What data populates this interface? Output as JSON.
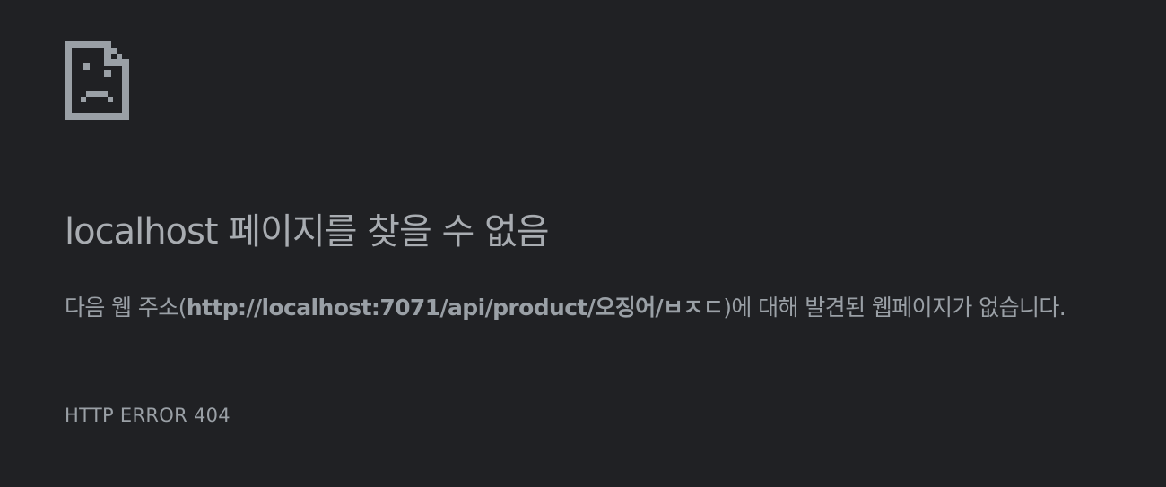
{
  "icon": "sad-page-icon",
  "colors": {
    "background": "#202124",
    "text": "#9aa0a6",
    "title": "#a8acb1",
    "icon": "#9aa0a6"
  },
  "error": {
    "title": "localhost 페이지를 찾을 수 없음",
    "description_prefix": "다음 웹 주소(",
    "url": "http://localhost:7071/api/product/오징어/ㅂㅈㄷ",
    "description_suffix": ")에 대해 발견된 웹페이지가 없습니다.",
    "code": "HTTP ERROR 404"
  }
}
